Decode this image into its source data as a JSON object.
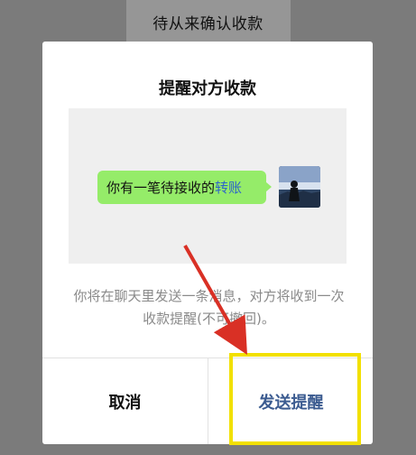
{
  "page": {
    "title": "待从来确认收款"
  },
  "dialog": {
    "title": "提醒对方收款",
    "message_preview": {
      "text_prefix": "你有一笔待接收的",
      "link_text": "转账"
    },
    "description": "你将在聊天里发送一条消息，对方将收到一次收款提醒(不可撤回)。",
    "buttons": {
      "cancel_label": "取消",
      "send_label": "发送提醒"
    }
  },
  "colors": {
    "accent": "#3b5b90",
    "bubble": "#95ec69",
    "link": "#2f65c8",
    "highlight": "#f2e000",
    "arrow": "#d93025"
  },
  "icons": {
    "avatar": "avatar-icon",
    "annotation_arrow": "red-arrow-icon"
  }
}
